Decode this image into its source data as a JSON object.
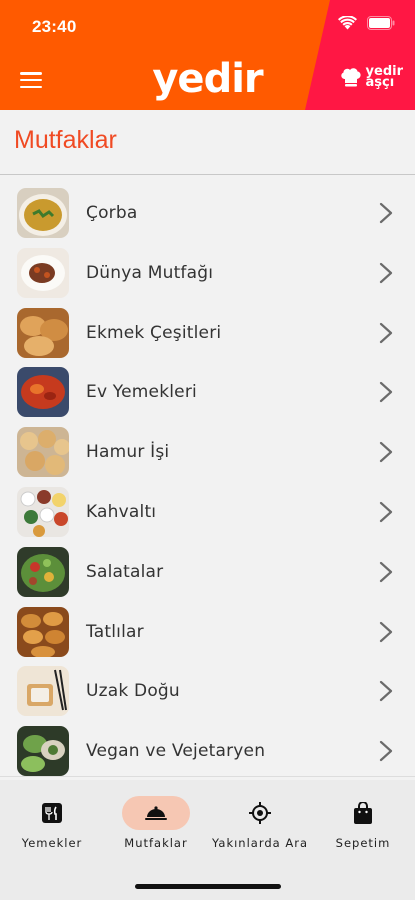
{
  "status_bar": {
    "time": "23:40"
  },
  "header": {
    "logo": "yedir",
    "badge_line1": "yedir",
    "badge_line2": "aşçı",
    "colors": {
      "primary": "#ff5a00",
      "secondary": "#ff1744"
    }
  },
  "page": {
    "title": "Mutfaklar",
    "title_color": "#f04a23"
  },
  "categories": [
    {
      "label": "Çorba",
      "icon": "soup-photo"
    },
    {
      "label": "Dünya Mutfağı",
      "icon": "world-cuisine-photo"
    },
    {
      "label": "Ekmek Çeşitleri",
      "icon": "bread-photo"
    },
    {
      "label": "Ev Yemekleri",
      "icon": "home-cooking-photo"
    },
    {
      "label": "Hamur İşi",
      "icon": "pastry-photo"
    },
    {
      "label": "Kahvaltı",
      "icon": "breakfast-photo"
    },
    {
      "label": "Salatalar",
      "icon": "salad-photo"
    },
    {
      "label": "Tatlılar",
      "icon": "dessert-photo"
    },
    {
      "label": "Uzak Doğu",
      "icon": "far-east-photo"
    },
    {
      "label": "Vegan ve Vejetaryen",
      "icon": "vegan-photo"
    }
  ],
  "bottom_nav": [
    {
      "label": "Yemekler",
      "icon": "utensils-icon",
      "active": false
    },
    {
      "label": "Mutfaklar",
      "icon": "cloche-icon",
      "active": true
    },
    {
      "label": "Yakınlarda Ara",
      "icon": "location-target-icon",
      "active": false
    },
    {
      "label": "Sepetim",
      "icon": "shopping-bag-icon",
      "active": false
    }
  ]
}
